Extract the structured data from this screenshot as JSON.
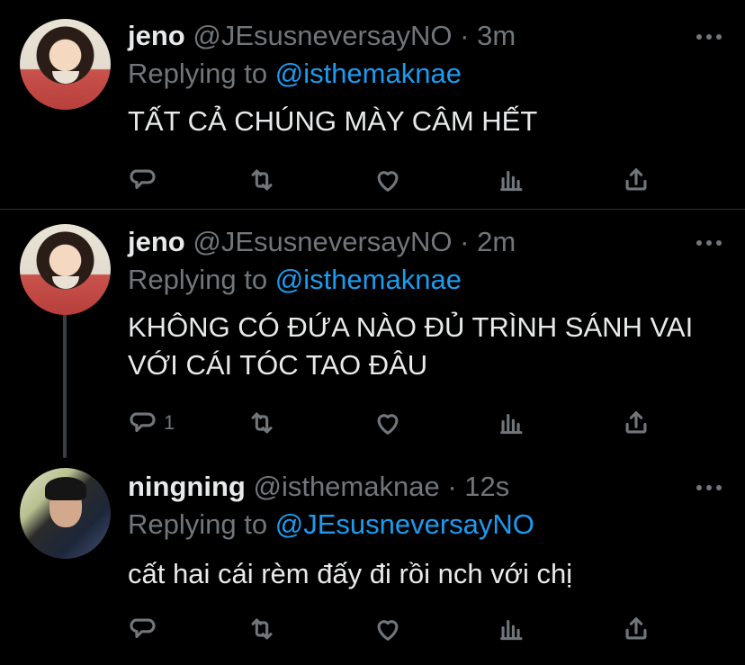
{
  "tweets": [
    {
      "name": "jeno",
      "handle": "@JEsusneversayNO",
      "separator": "·",
      "time": "3m",
      "replying_prefix": "Replying to",
      "replying_to": "@isthemaknae",
      "text": "TẤT CẢ CHÚNG MÀY CÂM HẾT",
      "reply_count": ""
    },
    {
      "name": "jeno",
      "handle": "@JEsusneversayNO",
      "separator": "·",
      "time": "2m",
      "replying_prefix": "Replying to",
      "replying_to": "@isthemaknae",
      "text": "KHÔNG CÓ ĐỨA NÀO ĐỦ TRÌNH SÁNH VAI VỚI CÁI TÓC TAO ĐÂU",
      "reply_count": "1"
    },
    {
      "name": "ningning",
      "handle": "@isthemaknae",
      "separator": "·",
      "time": "12s",
      "replying_prefix": "Replying to",
      "replying_to": "@JEsusneversayNO",
      "text": "cất hai cái rèm đấy đi rồi nch với chị",
      "reply_count": ""
    }
  ],
  "icons": {
    "reply": "reply-icon",
    "retweet": "retweet-icon",
    "like": "like-icon",
    "analytics": "analytics-icon",
    "share": "share-icon",
    "more": "more-icon"
  },
  "colors": {
    "background": "#000000",
    "text": "#e7e9ea",
    "secondary": "#71767b",
    "accent": "#1d9bf0",
    "divider": "#2f3336"
  }
}
